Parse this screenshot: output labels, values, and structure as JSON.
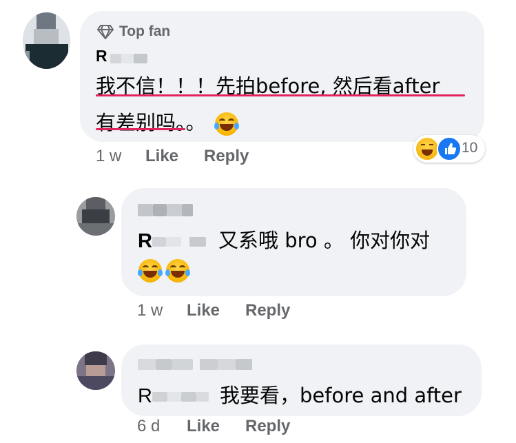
{
  "comments": [
    {
      "badge": "Top fan",
      "name_visible": "R",
      "text_line1": "我不信！！！先拍before, 然后看after",
      "text_line2": "有差别吗。。",
      "time": "1 w",
      "like": "Like",
      "reply": "Reply",
      "reaction_count": "10",
      "reaction_icons": [
        "laughing-emoji-icon",
        "like-thumb-icon"
      ]
    },
    {
      "text_line1": "又系哦 bro 。 你对你对",
      "mention_initial": "R",
      "time": "1 w",
      "like": "Like",
      "reply": "Reply"
    },
    {
      "text_line1": "我要看，before and after",
      "mention_initial": "R",
      "time": "6 d",
      "like": "Like",
      "reply": "Reply"
    }
  ],
  "colors": {
    "bubble": "#f0f2f5",
    "secondary_text": "#65676b",
    "underline": "#e0245e",
    "like_blue": "#1877f2"
  }
}
